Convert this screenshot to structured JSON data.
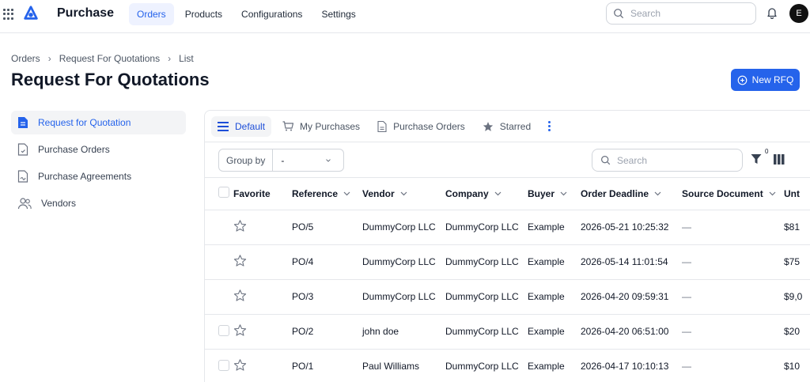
{
  "app": {
    "title": "Purchase",
    "avatar_initial": "E"
  },
  "nav": [
    {
      "label": "Orders",
      "active": true
    },
    {
      "label": "Products"
    },
    {
      "label": "Configurations"
    },
    {
      "label": "Settings"
    }
  ],
  "top_search": {
    "placeholder": "Search"
  },
  "breadcrumb": [
    "Orders",
    "Request For Quotations",
    "List"
  ],
  "page_title": "Request For Quotations",
  "new_button": "New RFQ",
  "sidebar": [
    {
      "label": "Request for Quotation",
      "icon": "document-icon",
      "active": true
    },
    {
      "label": "Purchase Orders",
      "icon": "file-icon"
    },
    {
      "label": "Purchase Agreements",
      "icon": "file-signed-icon"
    },
    {
      "label": "Vendors",
      "icon": "users-icon"
    }
  ],
  "tabs": [
    {
      "label": "Default",
      "icon": "list-icon",
      "active": true
    },
    {
      "label": "My Purchases",
      "icon": "cart-icon"
    },
    {
      "label": "Purchase Orders",
      "icon": "file-icon"
    },
    {
      "label": "Starred",
      "icon": "star-icon"
    }
  ],
  "toolbar": {
    "group_by_label": "Group by",
    "group_by_value": "-",
    "search_placeholder": "Search",
    "filter_count": "0"
  },
  "columns": [
    "Favorite",
    "Reference",
    "Vendor",
    "Company",
    "Buyer",
    "Order Deadline",
    "Source Document",
    "Unt"
  ],
  "rows": [
    {
      "reference": "PO/5",
      "vendor": "DummyCorp LLC",
      "company": "DummyCorp LLC",
      "buyer": "Example",
      "deadline": "2026-05-21 10:25:32",
      "source": "—",
      "untaxed": "$81",
      "checkbox": false
    },
    {
      "reference": "PO/4",
      "vendor": "DummyCorp LLC",
      "company": "DummyCorp LLC",
      "buyer": "Example",
      "deadline": "2026-05-14 11:01:54",
      "source": "—",
      "untaxed": "$75",
      "checkbox": false
    },
    {
      "reference": "PO/3",
      "vendor": "DummyCorp LLC",
      "company": "DummyCorp LLC",
      "buyer": "Example",
      "deadline": "2026-04-20 09:59:31",
      "source": "—",
      "untaxed": "$9,0",
      "checkbox": false
    },
    {
      "reference": "PO/2",
      "vendor": "john doe",
      "company": "DummyCorp LLC",
      "buyer": "Example",
      "deadline": "2026-04-20 06:51:00",
      "source": "—",
      "untaxed": "$20",
      "checkbox": true
    },
    {
      "reference": "PO/1",
      "vendor": "Paul Williams",
      "company": "DummyCorp LLC",
      "buyer": "Example",
      "deadline": "2026-04-17 10:10:13",
      "source": "—",
      "untaxed": "$10",
      "checkbox": true
    }
  ],
  "colors": {
    "accent": "#2563eb",
    "border": "#e5e7eb"
  }
}
